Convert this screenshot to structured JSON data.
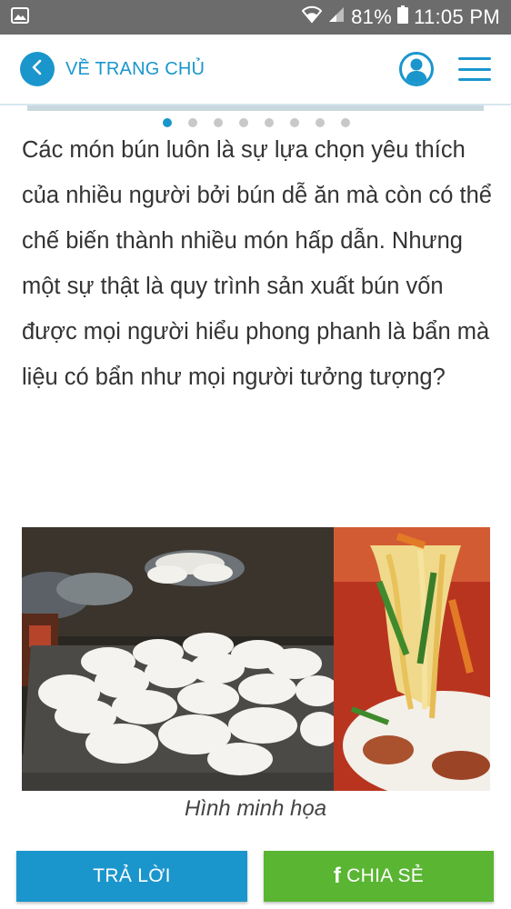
{
  "status_bar": {
    "battery_percent": "81%",
    "time": "11:05 PM",
    "icons": [
      "image-icon",
      "wifi-icon",
      "signal-icon",
      "battery-icon"
    ]
  },
  "header": {
    "back_label": "VỀ TRANG CHỦ",
    "icons": [
      "chevron-left-icon",
      "user-icon",
      "menu-icon"
    ]
  },
  "carousel": {
    "slide_count": 8,
    "active_index": 0
  },
  "article": {
    "paragraph": "Các món bún luôn là sự lựa chọn yêu thích của nhiều người bởi bún dễ ăn mà còn có thể chế biến thành nhiều món hấp dẫn. Nhưng một sự thật là quy trình sản xuất bún vốn được mọi người hiểu phong phanh là bẩn mà liệu có bẩn như mọi người tưởng tượng?",
    "figure_caption": "Hình minh họa"
  },
  "actions": {
    "reply_label": "TRẢ LỜI",
    "share_label": "CHIA SẺ",
    "share_icon": "facebook-icon"
  },
  "colors": {
    "accent": "#1a96cc",
    "share_green": "#5ab533",
    "status_bar": "#6c6c6c"
  }
}
